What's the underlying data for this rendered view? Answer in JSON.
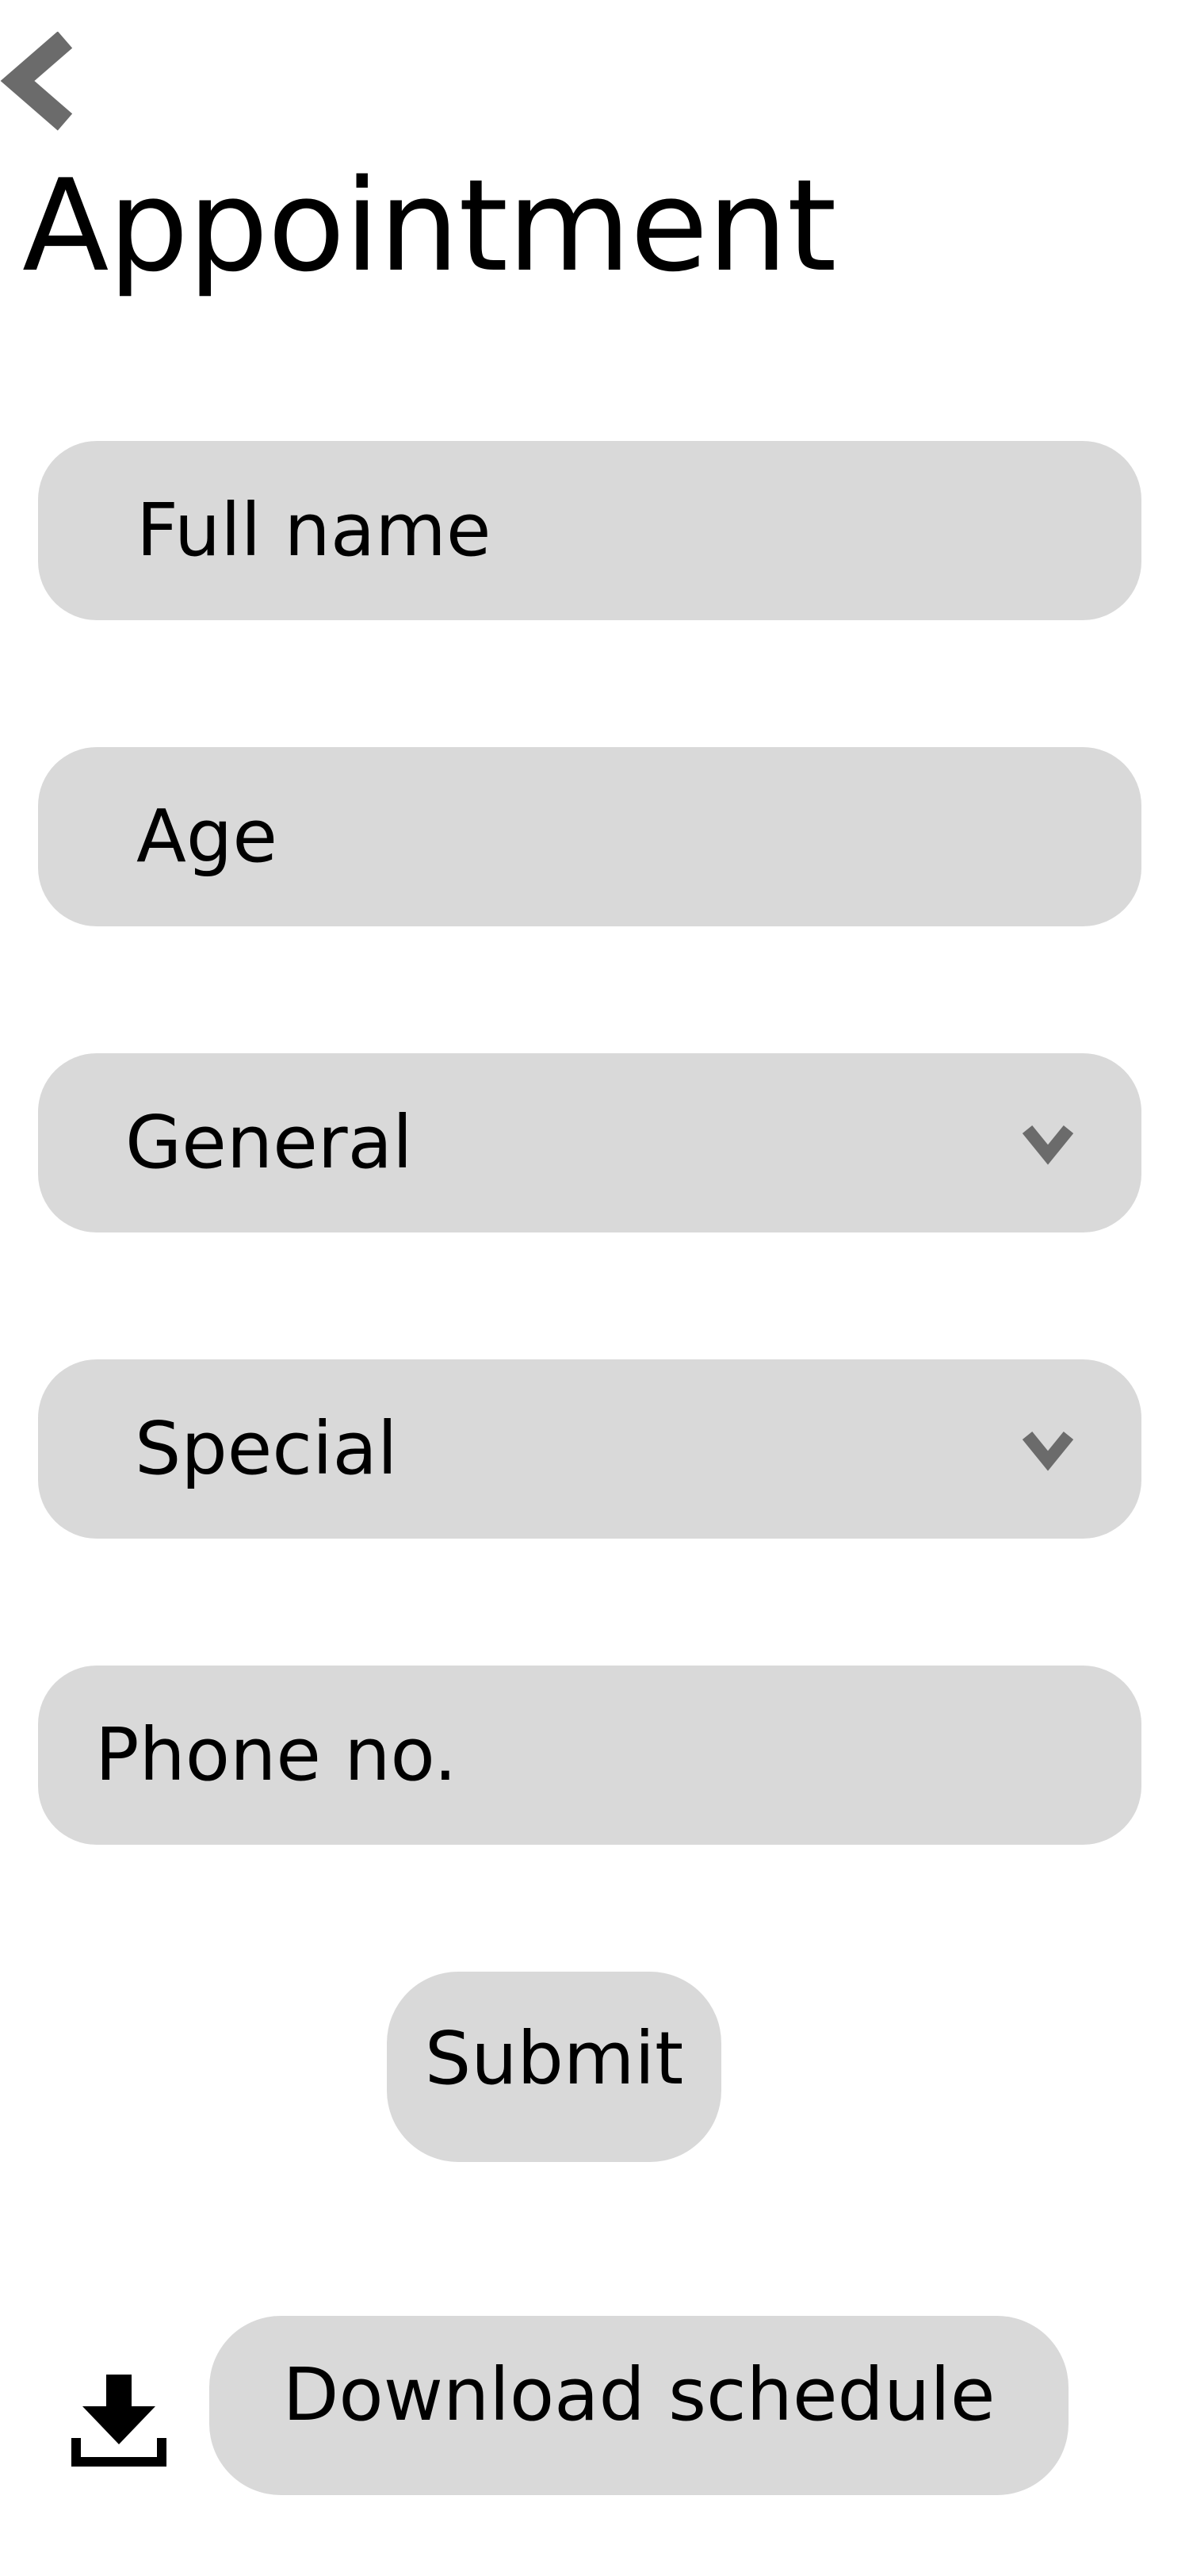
{
  "header": {
    "back_icon": "chevron-left-icon",
    "title": "Appointment"
  },
  "form": {
    "full_name": {
      "placeholder": "Full name"
    },
    "age": {
      "placeholder": "Age"
    },
    "general": {
      "selected": "General",
      "icon": "chevron-down-icon"
    },
    "special": {
      "selected": "Special",
      "icon": "chevron-down-icon"
    },
    "phone": {
      "placeholder": "Phone no."
    }
  },
  "actions": {
    "submit_label": "Submit",
    "download_label": "Download schedule",
    "download_icon": "download-icon"
  },
  "colors": {
    "background": "#ffffff",
    "field_fill": "#d9d9d9",
    "icon_gray": "#6b6b6b",
    "text": "#000000"
  }
}
